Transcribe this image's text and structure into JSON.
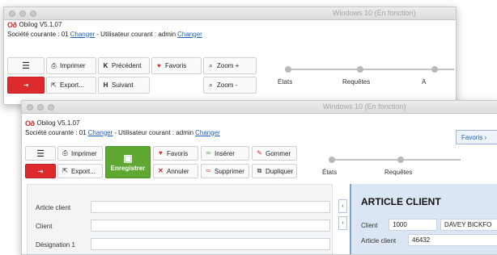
{
  "back_window": {
    "title": "Windows 10 (En fonction)",
    "app_title": "Obilog V5.1.07",
    "info": {
      "societe_prefix": "Société courante : 01",
      "change1": "Changer",
      "user_prefix": "- Utilisateur courant : admin",
      "change2": "Changer"
    },
    "toolbar": {
      "menu_glyph": "☰",
      "print": "Imprimer",
      "previous": "Précédent",
      "favorites": "Favoris",
      "zoom_in": "Zoom +",
      "logout_glyph": "⇥",
      "export": "Export...",
      "next": "Suivant",
      "zoom_out": "Zoom -"
    },
    "steps": [
      "États",
      "Requêtes",
      "A"
    ]
  },
  "front_window": {
    "title": "Windows 10 (En fonction)",
    "app_title": "Obilog V5.1.07",
    "info": {
      "societe_prefix": "Société courante : 01",
      "change1": "Changer",
      "user_prefix": "- Utilisateur courant : admin",
      "change2": "Changer"
    },
    "favoris_button": "Favoris ›",
    "toolbar": {
      "menu_glyph": "☰",
      "print": "Imprimer",
      "save": "Enregistrer",
      "favorites": "Favoris",
      "insert": "Insérer",
      "erase": "Gommer",
      "logout_glyph": "⇥",
      "export": "Export...",
      "cancel": "Annuler",
      "delete": "Supprimer",
      "duplicate": "Dupliquer"
    },
    "steps": [
      "États",
      "Requêtes"
    ],
    "form": {
      "labels": [
        "Article client",
        "Client",
        "Désignation 1"
      ]
    },
    "detail": {
      "title": "ARTICLE CLIENT",
      "client_label": "Client",
      "client_code": "1000",
      "client_name": "DAVEY BICKFO",
      "article_label": "Article client",
      "article_value": "46432"
    },
    "colors": {
      "accent_red": "#dc2a2d",
      "save_green": "#5ea831",
      "panel_blue": "#dbe6f4",
      "link_blue": "#1f5fbf"
    }
  }
}
